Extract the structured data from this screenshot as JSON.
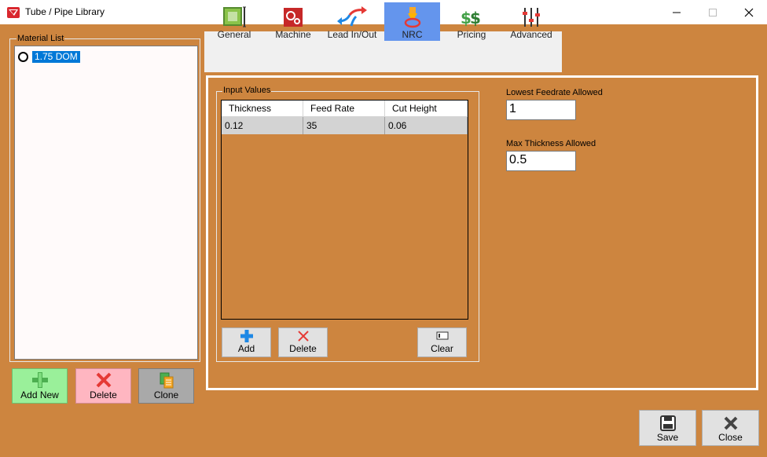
{
  "window": {
    "title": "Tube / Pipe Library"
  },
  "material_list": {
    "label": "Material List",
    "items": [
      {
        "label": "1.75 DOM",
        "selected": true
      }
    ]
  },
  "material_buttons": {
    "add": "Add New",
    "delete": "Delete",
    "clone": "Clone"
  },
  "tabs": [
    {
      "label": "General",
      "icon": "general-icon",
      "active": false
    },
    {
      "label": "Machine",
      "icon": "machine-gear-icon",
      "active": false
    },
    {
      "label": "Lead In/Out",
      "icon": "lead-in-out-arrows-icon",
      "active": false
    },
    {
      "label": "NRC",
      "icon": "nrc-torch-icon",
      "active": true
    },
    {
      "label": "Pricing",
      "icon": "pricing-dollar-icon",
      "active": false
    },
    {
      "label": "Advanced",
      "icon": "advanced-sliders-icon",
      "active": false
    }
  ],
  "input_values": {
    "label": "Input Values",
    "columns": [
      "Thickness",
      "Feed Rate",
      "Cut Height"
    ],
    "rows": [
      [
        "0.12",
        "35",
        "0.06"
      ]
    ],
    "buttons": {
      "add": "Add",
      "delete": "Delete",
      "clear": "Clear"
    }
  },
  "settings": {
    "lowest_feedrate_label": "Lowest Feedrate Allowed",
    "lowest_feedrate_value": "1",
    "max_thickness_label": "Max Thickness Allowed",
    "max_thickness_value": "0.5"
  },
  "footer": {
    "save": "Save",
    "close": "Close"
  },
  "colors": {
    "background": "#cd853f",
    "active_tab": "#6495ed",
    "selection": "#0078d7"
  }
}
